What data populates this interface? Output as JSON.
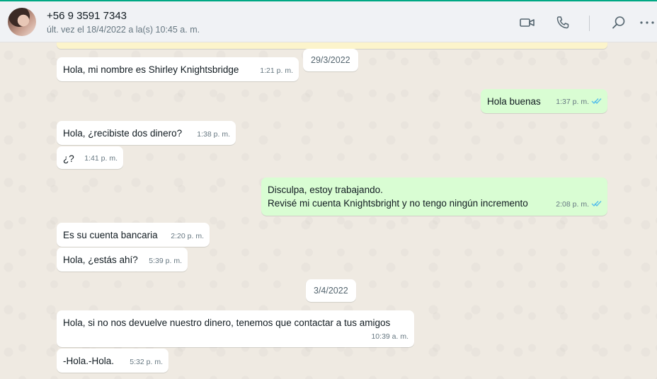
{
  "header": {
    "contact_name": "+56 9 3591 7343",
    "last_seen": "últ. vez el 18/4/2022 a la(s) 10:45 a. m.",
    "icons": [
      "video-call-icon",
      "voice-call-icon",
      "search-icon",
      "menu-icon"
    ],
    "accent": "#00a884"
  },
  "chat": {
    "date_1": "29/3/2022",
    "date_2": "3/4/2022",
    "messages": [
      {
        "dir": "in",
        "text": "Hola, mi nombre es Shirley Knightsbridge",
        "time": "1:21 p. m."
      },
      {
        "dir": "out",
        "text": "Hola buenas",
        "time": "1:37 p. m.",
        "read": true
      },
      {
        "dir": "in",
        "text": "Hola, ¿recibiste dos dinero?",
        "time": "1:38 p. m."
      },
      {
        "dir": "in",
        "text": "¿?",
        "time": "1:41 p. m."
      },
      {
        "dir": "out",
        "line1": "Disculpa, estoy trabajando.",
        "line2": "Revisé mi cuenta Knightsbright y no tengo ningún incremento",
        "time": "2:08 p. m.",
        "read": true
      },
      {
        "dir": "in",
        "text": "Es su cuenta bancaria",
        "time": "2:20 p. m."
      },
      {
        "dir": "in",
        "text": "Hola, ¿estás ahí?",
        "time": "5:39 p. m."
      },
      {
        "dir": "in",
        "text": "Hola, si no nos devuelve nuestro dinero, tenemos que contactar a tus amigos",
        "time": "10:39 a. m."
      },
      {
        "dir": "in",
        "text": "-Hola.-Hola.",
        "time": "5:32 p. m."
      }
    ]
  },
  "colors": {
    "incoming_bubble": "#ffffff",
    "outgoing_bubble": "#d9fdd3",
    "chat_background": "#efeae2",
    "read_ticks": "#53bdeb"
  }
}
